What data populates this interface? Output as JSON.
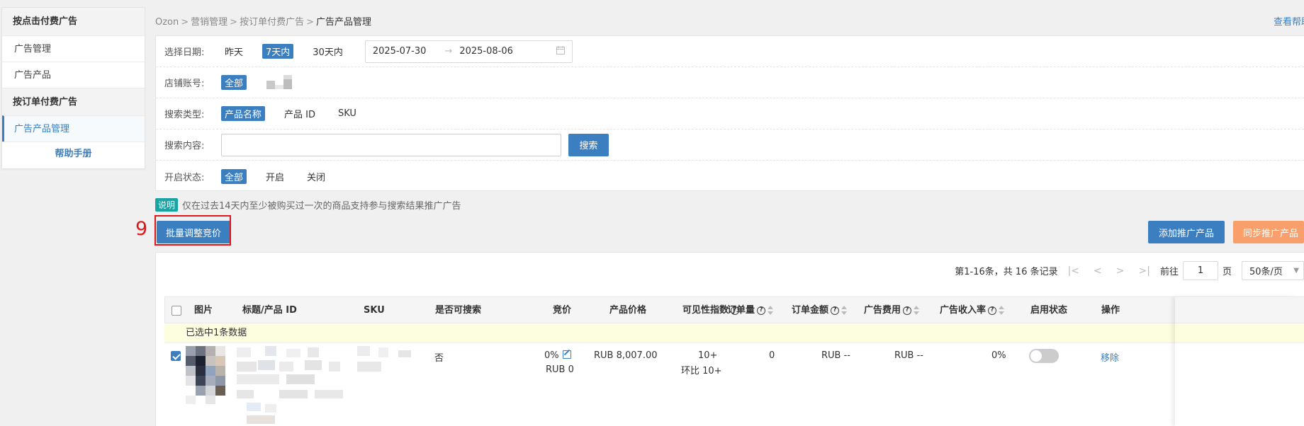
{
  "sidebar": {
    "group1": "按点击付费广告",
    "items1": [
      "广告管理",
      "广告产品"
    ],
    "group2": "按订单付费广告",
    "items2": [
      "广告产品管理"
    ],
    "help": "帮助手册"
  },
  "breadcrumb": [
    "Ozon",
    "营销管理",
    "按订单付费广告",
    "广告产品管理"
  ],
  "help_link": "查看帮助",
  "filters": {
    "date_label": "选择日期:",
    "date_options": [
      "昨天",
      "7天内",
      "30天内"
    ],
    "date_start": "2025-07-30",
    "date_end": "2025-08-06",
    "store_label": "店铺账号:",
    "store_all": "全部",
    "search_type_label": "搜索类型:",
    "search_types": [
      "产品名称",
      "产品 ID",
      "SKU"
    ],
    "search_content_label": "搜索内容:",
    "search_value": "",
    "search_button": "搜索",
    "status_label": "开启状态:",
    "status_options": [
      "全部",
      "开启",
      "关闭"
    ]
  },
  "note": {
    "badge": "说明",
    "text": "仅在过去14天内至少被购买过一次的商品支持参与搜索结果推广广告"
  },
  "annotation_number": "9",
  "actions": {
    "batch": "批量调整竞价",
    "add": "添加推广产品",
    "sync": "同步推广产品"
  },
  "pager": {
    "summary": "第1-16条，共 16 条记录",
    "goto_prefix": "前往",
    "goto_value": "1",
    "goto_suffix": "页",
    "page_size": "50条/页"
  },
  "table": {
    "headers": [
      "图片",
      "标题/产品 ID",
      "SKU",
      "是否可搜索",
      "竞价",
      "产品价格",
      "可见性指数",
      "订单量",
      "订单金额",
      "广告费用",
      "广告收入率",
      "启用状态",
      "操作"
    ],
    "selection_text": "已选中1条数据",
    "row": {
      "searchable": "否",
      "bid": "0%",
      "bid_sub": "RUB 0",
      "price": "RUB 8,007.00",
      "visibility": "10+",
      "visibility_sub": "环比 10+",
      "orders": "0",
      "order_amount": "RUB --",
      "ad_cost": "RUB --",
      "ad_rate": "0%",
      "action": "移除"
    }
  }
}
